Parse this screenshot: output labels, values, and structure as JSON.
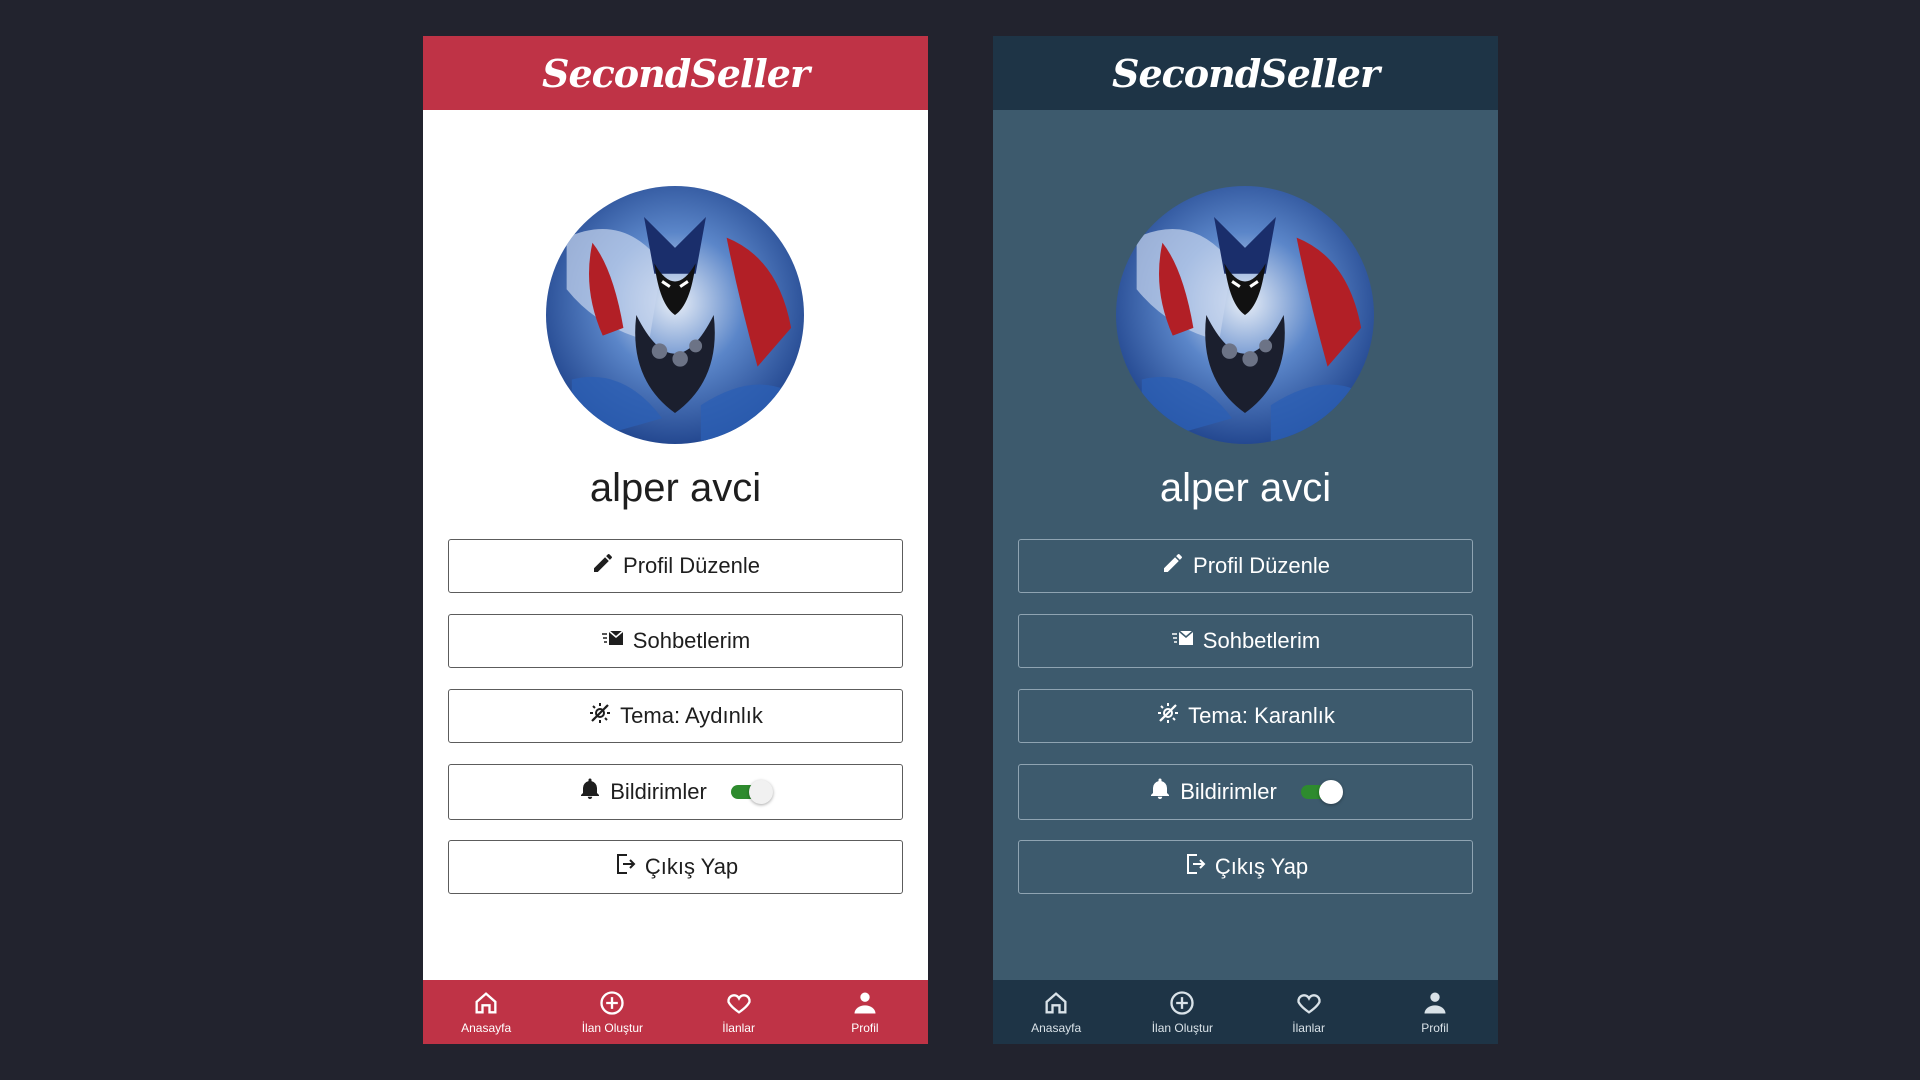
{
  "colors": {
    "light_accent": "#bf3346",
    "dark_bar": "#1e3446",
    "dark_bg": "#3d5a6d",
    "toggle_green": "#2e8b2e"
  },
  "screens": [
    {
      "id": "light",
      "brand": "SecondSeller",
      "username": "alper avci",
      "menu": {
        "edit_profile": "Profil Düzenle",
        "chats": "Sohbetlerim",
        "theme": "Tema: Aydınlık",
        "notifications": "Bildirimler",
        "notifications_on": true,
        "logout": "Çıkış Yap"
      },
      "nav": [
        {
          "label": "Anasayfa",
          "icon": "home-icon"
        },
        {
          "label": "İlan Oluştur",
          "icon": "add-circle-icon"
        },
        {
          "label": "İlanlar",
          "icon": "heart-icon"
        },
        {
          "label": "Profil",
          "icon": "person-icon"
        }
      ]
    },
    {
      "id": "dark",
      "brand": "SecondSeller",
      "username": "alper avci",
      "menu": {
        "edit_profile": "Profil Düzenle",
        "chats": "Sohbetlerim",
        "theme": "Tema: Karanlık",
        "notifications": "Bildirimler",
        "notifications_on": true,
        "logout": "Çıkış Yap"
      },
      "nav": [
        {
          "label": "Anasayfa",
          "icon": "home-icon"
        },
        {
          "label": "İlan Oluştur",
          "icon": "add-circle-icon"
        },
        {
          "label": "İlanlar",
          "icon": "heart-icon"
        },
        {
          "label": "Profil",
          "icon": "person-icon"
        }
      ]
    }
  ]
}
